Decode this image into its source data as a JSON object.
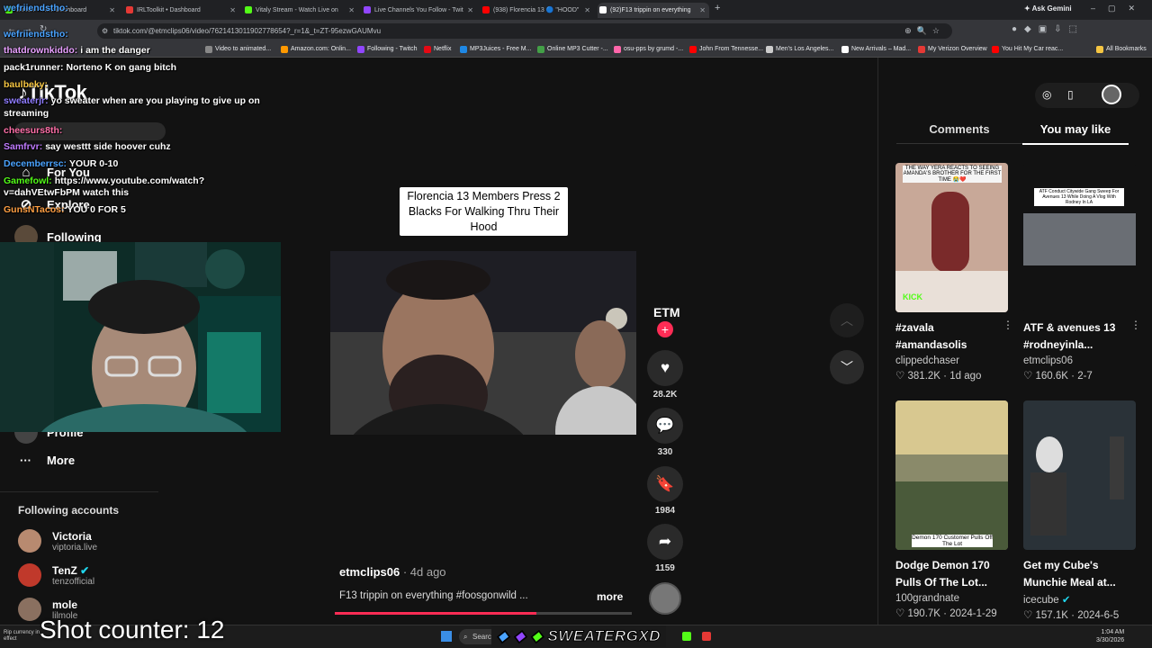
{
  "browser": {
    "tabs": [
      {
        "label": "Stream - Kick Dashboard",
        "color": "#53fc18"
      },
      {
        "label": "IRLToolkit • Dashboard",
        "color": "#e53935"
      },
      {
        "label": "Vitaly Stream - Watch Live on",
        "color": "#53fc18"
      },
      {
        "label": "Live Channels You Follow - Twit",
        "color": "#9146ff"
      },
      {
        "label": "(938) Florencia 13 🔵 \"HOOD\"",
        "color": "#ff0000"
      },
      {
        "label": "(92)F13 trippin on everything",
        "color": "#ffffff"
      }
    ],
    "ask_gemini": "Ask Gemini",
    "url": "tiktok.com/@etmclips06/video/7621413011902778654?_r=1&_t=ZT-95ezwGAUMvu",
    "bookmarks": [
      {
        "label": "Video to animated...",
        "color": "#888888"
      },
      {
        "label": "Amazon.com: Onlin...",
        "color": "#ff9900"
      },
      {
        "label": "Following - Twitch",
        "color": "#9146ff"
      },
      {
        "label": "Netflix",
        "color": "#e50914"
      },
      {
        "label": "MP3Juices - Free M...",
        "color": "#1e88e5"
      },
      {
        "label": "Online MP3 Cutter -...",
        "color": "#43a047"
      },
      {
        "label": "osu-pps by grumd -...",
        "color": "#ff66aa"
      },
      {
        "label": "John From Tennesse...",
        "color": "#ff0000"
      },
      {
        "label": "Men's Los Angeles...",
        "color": "#cccccc"
      },
      {
        "label": "New Arrivals – Mad...",
        "color": "#ffffff"
      },
      {
        "label": "My Verizon Overview",
        "color": "#e53935"
      },
      {
        "label": "You Hit My Car reac...",
        "color": "#ff0000"
      }
    ],
    "all_bookmarks": "All Bookmarks"
  },
  "chat": [
    {
      "user": "wefriiendstho:",
      "msg": "",
      "color": "#4aa3ff"
    },
    {
      "user": "wefriiendstho:",
      "msg": "",
      "color": "#4aa3ff"
    },
    {
      "user": "thatdrownkiddo:",
      "msg": "i am the danger",
      "color": "#e8a0ff"
    },
    {
      "user": "pack1runner:",
      "msg": "Norteno K on gang bitch",
      "color": "#ffffff"
    },
    {
      "user": "baulbeky:",
      "msg": "",
      "color": "#f5c542"
    },
    {
      "user": "sweaterjr:",
      "msg": "yo sweater when are you playing to give up on",
      "color": "#8f7cff"
    },
    {
      "user": "",
      "msg": "streaming",
      "color": "#ffffff"
    },
    {
      "user": "cheesurs8th:",
      "msg": "",
      "color": "#ff6fa8"
    },
    {
      "user": "Samfrvr:",
      "msg": "say westtt side hoover cuhz",
      "color": "#c07bff"
    },
    {
      "user": "Decemberrsc:",
      "msg": "YOUR 0-10",
      "color": "#4aa3ff"
    },
    {
      "user": "Gamefowl:",
      "msg": "https://www.youtube.com/watch?",
      "color": "#53fc18"
    },
    {
      "user": "",
      "msg": "v=dahVEtwFbPM watch this",
      "color": "#ffffff"
    },
    {
      "user": "GunsNTacos:",
      "msg": "YOU 0 FOR 5",
      "color": "#ff9f43"
    }
  ],
  "sidebar": {
    "logo": "TikTok",
    "nav": [
      "For You",
      "Explore",
      "Following",
      "Profile",
      "More"
    ],
    "following_title": "Following accounts",
    "accounts": [
      {
        "name": "Victoria",
        "handle": "viptoria.live",
        "color": "#b88a70"
      },
      {
        "name": "TenZ",
        "handle": "tenzofficial",
        "color": "#c0392b"
      },
      {
        "name": "mole",
        "handle": "lilmole",
        "color": "#8a7060"
      }
    ]
  },
  "video": {
    "caption": "Florencia 13 Members Press 2 Blacks For Walking Thru Their Hood",
    "author": "etmclips06",
    "age": "4d ago",
    "description": "F13 trippin on everything #foosgonwild ...",
    "more": "more",
    "brand": "ETM",
    "likes": "28.2K",
    "comments": "330",
    "saves": "1984",
    "shares": "1159",
    "progress": 0.68
  },
  "panel": {
    "tabs": [
      "Comments",
      "You may like"
    ],
    "active_tab": "You may like",
    "cards": [
      {
        "title": "#zavala #amandasolis",
        "user": "clippedchaser",
        "likes": "381.2K",
        "date": "1d ago",
        "verified": false,
        "thumb_text": "THE WAY YERA REACTS TO SEEING AMANDA'S BROTHER FOR THE FIRST TIME 😭❤️"
      },
      {
        "title": "ATF & avenues 13 #rodneyinla...",
        "user": "etmclips06",
        "likes": "160.6K",
        "date": "2-7",
        "verified": false,
        "thumb_text": "ATF Conduct Citywide Gang Sweep For Avenues 13 While Doing A Vlog With Rodney In LA"
      },
      {
        "title": "Dodge Demon 170 Pulls Of The Lot...",
        "user": "100grandnate",
        "likes": "190.7K",
        "date": "2024-1-29",
        "verified": false,
        "thumb_text": "Demon 170 Customer Pulls Off The Lot"
      },
      {
        "title": "Get my Cube's Munchie Meal at...",
        "user": "icecube",
        "likes": "157.1K",
        "date": "2024-6-5",
        "verified": true,
        "thumb_text": ""
      }
    ]
  },
  "overlay": {
    "shot_counter": "Shot counter: 12",
    "banner": "SWEATERGXD",
    "notification": "Rip currency in effect"
  },
  "taskbar": {
    "search": "Search",
    "time": "1:04 AM",
    "date": "3/30/2026"
  }
}
